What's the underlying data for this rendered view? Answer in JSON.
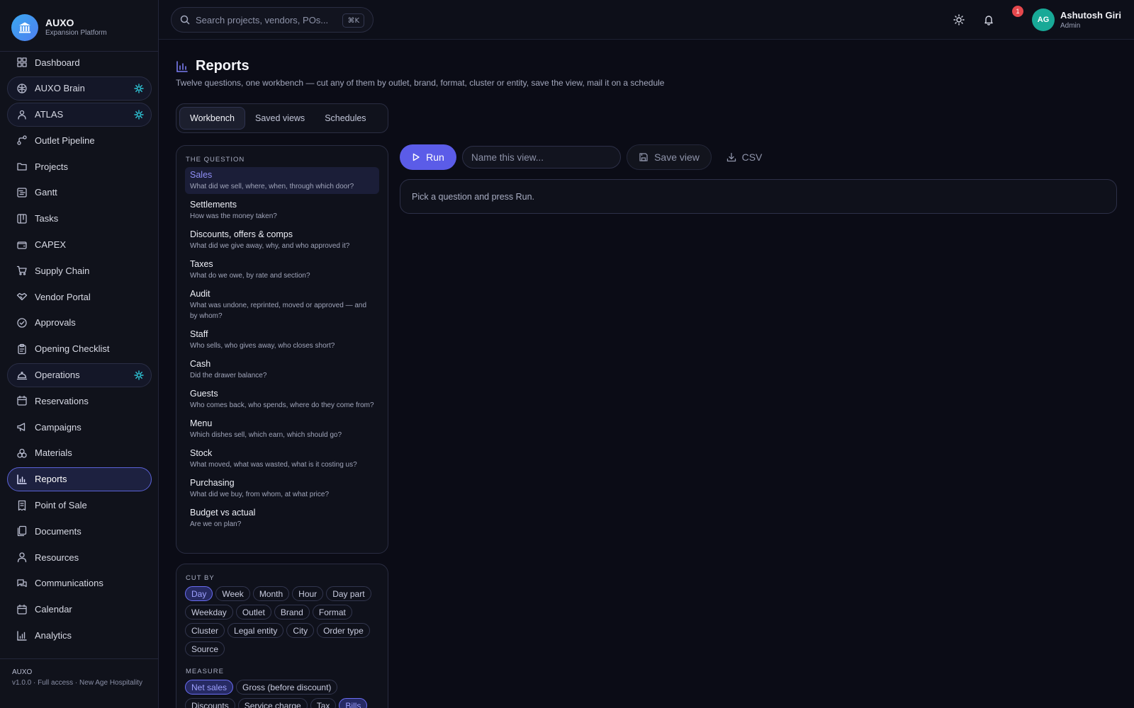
{
  "brand": {
    "name": "AUXO",
    "tagline": "Expansion Platform"
  },
  "nav": [
    {
      "label": "Dashboard",
      "icon": "dashboard-icon"
    },
    {
      "label": "AUXO Brain",
      "icon": "brain-icon",
      "pill": true,
      "spark": true
    },
    {
      "label": "ATLAS",
      "icon": "atlas-icon",
      "pill": true,
      "spark": true
    },
    {
      "label": "Outlet Pipeline",
      "icon": "pipeline-icon"
    },
    {
      "label": "Projects",
      "icon": "folder-icon"
    },
    {
      "label": "Gantt",
      "icon": "gantt-icon"
    },
    {
      "label": "Tasks",
      "icon": "tasks-icon"
    },
    {
      "label": "CAPEX",
      "icon": "wallet-icon"
    },
    {
      "label": "Supply Chain",
      "icon": "cart-icon"
    },
    {
      "label": "Vendor Portal",
      "icon": "handshake-icon"
    },
    {
      "label": "Approvals",
      "icon": "check-circle-icon"
    },
    {
      "label": "Opening Checklist",
      "icon": "clipboard-icon"
    },
    {
      "label": "Operations",
      "icon": "cloche-icon",
      "pill": true,
      "spark": true
    },
    {
      "label": "Reservations",
      "icon": "calendar-icon"
    },
    {
      "label": "Campaigns",
      "icon": "megaphone-icon"
    },
    {
      "label": "Materials",
      "icon": "materials-icon"
    },
    {
      "label": "Reports",
      "icon": "bar-chart-icon",
      "active": true
    },
    {
      "label": "Point of Sale",
      "icon": "receipt-icon"
    },
    {
      "label": "Documents",
      "icon": "documents-icon"
    },
    {
      "label": "Resources",
      "icon": "people-icon"
    },
    {
      "label": "Communications",
      "icon": "chat-icon"
    },
    {
      "label": "Calendar",
      "icon": "calendar-icon"
    },
    {
      "label": "Analytics",
      "icon": "analytics-icon"
    }
  ],
  "footer": {
    "title": "AUXO",
    "line": "v1.0.0 · Full access · New Age Hospitality"
  },
  "topbar": {
    "search_placeholder": "Search projects, vendors, POs...",
    "search_shortcut": "⌘K",
    "notification_count": "1",
    "user_initials": "AG",
    "user_name": "Ashutosh Giri",
    "user_role": "Admin"
  },
  "page": {
    "title": "Reports",
    "subtitle": "Twelve questions, one workbench — cut any of them by outlet, brand, format, cluster or entity, save the view, mail it on a schedule"
  },
  "tabs": [
    "Workbench",
    "Saved views",
    "Schedules"
  ],
  "questions_label": "THE QUESTION",
  "questions": [
    {
      "title": "Sales",
      "desc": "What did we sell, where, when, through which door?",
      "active": true
    },
    {
      "title": "Settlements",
      "desc": "How was the money taken?"
    },
    {
      "title": "Discounts, offers & comps",
      "desc": "What did we give away, why, and who approved it?"
    },
    {
      "title": "Taxes",
      "desc": "What do we owe, by rate and section?"
    },
    {
      "title": "Audit",
      "desc": "What was undone, reprinted, moved or approved — and by whom?"
    },
    {
      "title": "Staff",
      "desc": "Who sells, who gives away, who closes short?"
    },
    {
      "title": "Cash",
      "desc": "Did the drawer balance?"
    },
    {
      "title": "Guests",
      "desc": "Who comes back, who spends, where do they come from?"
    },
    {
      "title": "Menu",
      "desc": "Which dishes sell, which earn, which should go?"
    },
    {
      "title": "Stock",
      "desc": "What moved, what was wasted, what is it costing us?"
    },
    {
      "title": "Purchasing",
      "desc": "What did we buy, from whom, at what price?"
    },
    {
      "title": "Budget vs actual",
      "desc": "Are we on plan?"
    }
  ],
  "cut_by_label": "CUT BY",
  "cut_by": [
    {
      "label": "Day",
      "on": true
    },
    {
      "label": "Week"
    },
    {
      "label": "Month"
    },
    {
      "label": "Hour"
    },
    {
      "label": "Day part"
    },
    {
      "label": "Weekday"
    },
    {
      "label": "Outlet"
    },
    {
      "label": "Brand"
    },
    {
      "label": "Format"
    },
    {
      "label": "Cluster"
    },
    {
      "label": "Legal entity"
    },
    {
      "label": "City"
    },
    {
      "label": "Order type"
    },
    {
      "label": "Source"
    }
  ],
  "measure_label": "MEASURE",
  "measures": [
    {
      "label": "Net sales",
      "on": true
    },
    {
      "label": "Gross (before discount)"
    },
    {
      "label": "Discounts"
    },
    {
      "label": "Service charge"
    },
    {
      "label": "Tax"
    },
    {
      "label": "Bills",
      "on": true
    }
  ],
  "toolbar": {
    "run_label": "Run",
    "name_placeholder": "Name this view...",
    "save_label": "Save view",
    "csv_label": "CSV"
  },
  "result_message": "Pick a question and press Run.",
  "colors": {
    "accent": "#5b5ce8",
    "active_text": "#8f8ff7",
    "spark": "#2ec4d6",
    "avatar": "#18a997"
  }
}
